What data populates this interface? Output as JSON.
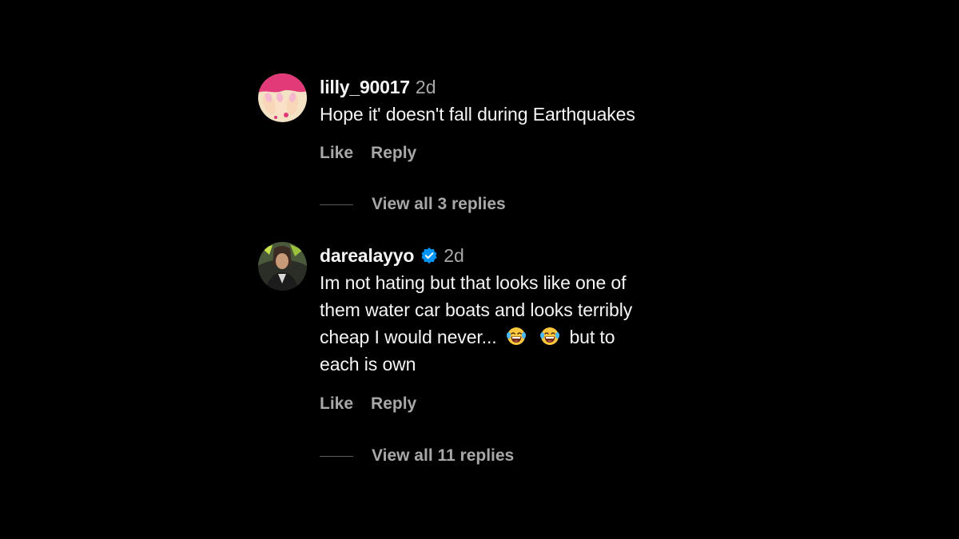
{
  "colors": {
    "background": "#000000",
    "text_primary": "#f5f5f5",
    "text_secondary": "#a8a8a8",
    "verified_badge": "#0095f6"
  },
  "comments": [
    {
      "username": "lilly_90017",
      "verified": false,
      "time": "2d",
      "text": [
        "Hope it' doesn't fall during Earthquakes"
      ],
      "like_label": "Like",
      "reply_label": "Reply",
      "view_replies_label": "View all 3 replies",
      "avatar_icon": "nails-avatar"
    },
    {
      "username": "darealayyo",
      "verified": true,
      "verified_icon": "verified-badge-icon",
      "time": "2d",
      "text_lines": {
        "l1": "Im not hating but that looks like one of",
        "l2": "them water car boats and looks terribly",
        "l3_before": "cheap I would never...",
        "l3_after": "but to",
        "l4": "each is own"
      },
      "emojis": [
        "tears-of-joy-emoji",
        "tears-of-joy-emoji"
      ],
      "like_label": "Like",
      "reply_label": "Reply",
      "view_replies_label": "View all 11 replies",
      "avatar_icon": "person-avatar"
    }
  ]
}
